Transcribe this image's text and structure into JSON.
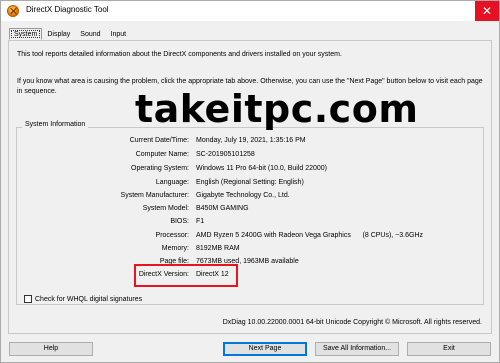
{
  "window": {
    "title": "DirectX Diagnostic Tool",
    "close_glyph": "✕"
  },
  "tabs": [
    {
      "label": "System",
      "active": true
    },
    {
      "label": "Display",
      "active": false
    },
    {
      "label": "Sound",
      "active": false
    },
    {
      "label": "Input",
      "active": false
    }
  ],
  "intro_text": "This tool reports detailed information about the DirectX components and drivers installed on your system.",
  "instructions_text": "If you know what area is causing the problem, click the appropriate tab above.  Otherwise, you can use the \"Next Page\" button below to visit each page in sequence.",
  "watermark_text": "takeitpc.com",
  "system_info": {
    "group_label": "System Information",
    "rows": [
      {
        "label": "Current Date/Time:",
        "value": "Monday, July 19, 2021, 1:35:16 PM"
      },
      {
        "label": "Computer Name:",
        "value": "SC-201905101258"
      },
      {
        "label": "Operating System:",
        "value": "Windows 11 Pro 64-bit (10.0, Build 22000)"
      },
      {
        "label": "Language:",
        "value": "English (Regional Setting: English)"
      },
      {
        "label": "System Manufacturer:",
        "value": "Gigabyte Technology Co., Ltd."
      },
      {
        "label": "System Model:",
        "value": "B450M GAMING"
      },
      {
        "label": "BIOS:",
        "value": "F1"
      },
      {
        "label": "Processor:",
        "value": "AMD Ryzen 5 2400G with Radeon Vega Graphics      (8 CPUs), ~3.6GHz"
      },
      {
        "label": "Memory:",
        "value": "8192MB RAM"
      },
      {
        "label": "Page file:",
        "value": "7673MB used, 1963MB available"
      },
      {
        "label": "DirectX Version:",
        "value": "DirectX 12"
      }
    ]
  },
  "whql_checkbox_label": "Check for WHQL digital signatures",
  "whql_checked": false,
  "footer_text": "DxDiag 10.00.22000.0001 64-bit Unicode  Copyright © Microsoft. All rights reserved.",
  "buttons": {
    "help": "Help",
    "next_page": "Next Page",
    "save_all": "Save All Information...",
    "exit": "Exit"
  },
  "colors": {
    "highlight_box": "#e8141e",
    "close_button": "#e81123",
    "primary_button_border": "#0078d7"
  }
}
